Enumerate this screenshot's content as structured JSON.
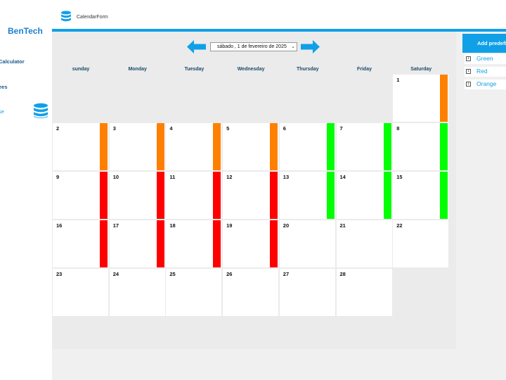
{
  "sidebar": {
    "brand": "BenTech",
    "items": [
      {
        "label": "Calculator"
      },
      {
        "label": "ees"
      },
      {
        "label": "se"
      }
    ]
  },
  "header": {
    "form_title": "CalendarForm"
  },
  "date_picker": {
    "value": "sábado    ,   1 de fevereiro  de 2025"
  },
  "weekdays": [
    "sunday",
    "Monday",
    "Tuesday",
    "Wednesday",
    "Thursday",
    "Friday",
    "Saturday"
  ],
  "colors": {
    "orange": "#ff8000",
    "green": "#00ff00",
    "red": "#ff0000",
    "accent": "#10a0e8"
  },
  "calendar": {
    "first_weekday_index": 6,
    "days": [
      {
        "day": "1",
        "color": "orange"
      },
      {
        "day": "2",
        "color": "orange"
      },
      {
        "day": "3",
        "color": "orange"
      },
      {
        "day": "4",
        "color": "orange"
      },
      {
        "day": "5",
        "color": "orange"
      },
      {
        "day": "6",
        "color": "green"
      },
      {
        "day": "7",
        "color": "green"
      },
      {
        "day": "8",
        "color": "green"
      },
      {
        "day": "9",
        "color": "red"
      },
      {
        "day": "10",
        "color": "red"
      },
      {
        "day": "11",
        "color": "red"
      },
      {
        "day": "12",
        "color": "red"
      },
      {
        "day": "13",
        "color": "green"
      },
      {
        "day": "14",
        "color": "green"
      },
      {
        "day": "15",
        "color": "green"
      },
      {
        "day": "16",
        "color": "red"
      },
      {
        "day": "17",
        "color": "red"
      },
      {
        "day": "18",
        "color": "red"
      },
      {
        "day": "19",
        "color": "red"
      },
      {
        "day": "20",
        "color": null
      },
      {
        "day": "21",
        "color": null
      },
      {
        "day": "22",
        "color": null
      },
      {
        "day": "23",
        "color": null
      },
      {
        "day": "24",
        "color": null
      },
      {
        "day": "25",
        "color": null
      },
      {
        "day": "26",
        "color": null
      },
      {
        "day": "27",
        "color": null
      },
      {
        "day": "28",
        "color": null
      }
    ]
  },
  "right_panel": {
    "add_button": "Add predefi",
    "items": [
      {
        "label": "Green"
      },
      {
        "label": "Red"
      },
      {
        "label": "Orange"
      }
    ]
  }
}
